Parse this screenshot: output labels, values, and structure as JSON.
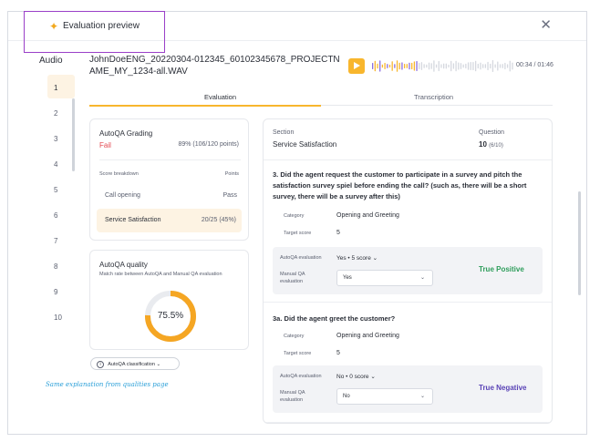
{
  "header": {
    "title": "Evaluation preview",
    "icon": "sparkle-icon",
    "close_icon": "close-icon"
  },
  "audio": {
    "label": "Audio",
    "items": [
      "1",
      "2",
      "3",
      "4",
      "5",
      "6",
      "7",
      "8",
      "9",
      "10"
    ],
    "active_index": 0
  },
  "player": {
    "filename": "JohnDoeENG_20220304-012345_60102345678_PROJECTNAME_MY_1234-all.WAV",
    "timestamp": "00:34 / 01:46",
    "progress_fraction": 0.32,
    "accent_color": "#f8b62d"
  },
  "tabs": {
    "evaluation": "Evaluation",
    "transcription": "Transcription",
    "active": "evaluation"
  },
  "grading": {
    "title": "AutoQA Grading",
    "result": "Fail",
    "score": "89% (106/120 points)",
    "breakdown_label": "Score breakdown",
    "points_label": "Points",
    "rows": [
      {
        "label": "Call opening",
        "value": "Pass"
      },
      {
        "label": "Service Satisfaction",
        "value": "20/25 (45%)"
      }
    ]
  },
  "quality": {
    "title": "AutoQA quality",
    "subtitle": "Match rate between AutoQA and Manual QA evaluation",
    "value": "75.5%",
    "fraction": 0.755,
    "ring_color": "#f5a623"
  },
  "classification": {
    "label": "AutoQA classification",
    "info_icon": "info-icon"
  },
  "annotation": "Same explanation from qualities page",
  "section": {
    "section_label": "Section",
    "section_value": "Service Satisfaction",
    "question_label": "Question",
    "question_value": "10",
    "question_total": "(6/10)"
  },
  "questions": [
    {
      "number": "3.",
      "text": "Did the agent request the customer to participate in a survey and pitch the satisfaction survey spiel before ending the call? (such as, there will be a short survey, there will be a survey after this)",
      "category_label": "Category",
      "category": "Opening and Greeting",
      "target_label": "Target score",
      "target": "5",
      "autoqa_label": "AutoQA evaluation",
      "autoqa_value": "Yes • 5 score",
      "manual_label": "Manual QA evaluation",
      "manual_value": "Yes",
      "result": "True Positive"
    },
    {
      "number": "3a.",
      "text": "Did the agent greet the customer?",
      "category_label": "Category",
      "category": "Opening and Greeting",
      "target_label": "Target score",
      "target": "5",
      "autoqa_label": "AutoQA evaluation",
      "autoqa_value": "No • 0 score",
      "manual_label": "Manual QA evaluation",
      "manual_value": "No",
      "result": "True Negative"
    }
  ]
}
